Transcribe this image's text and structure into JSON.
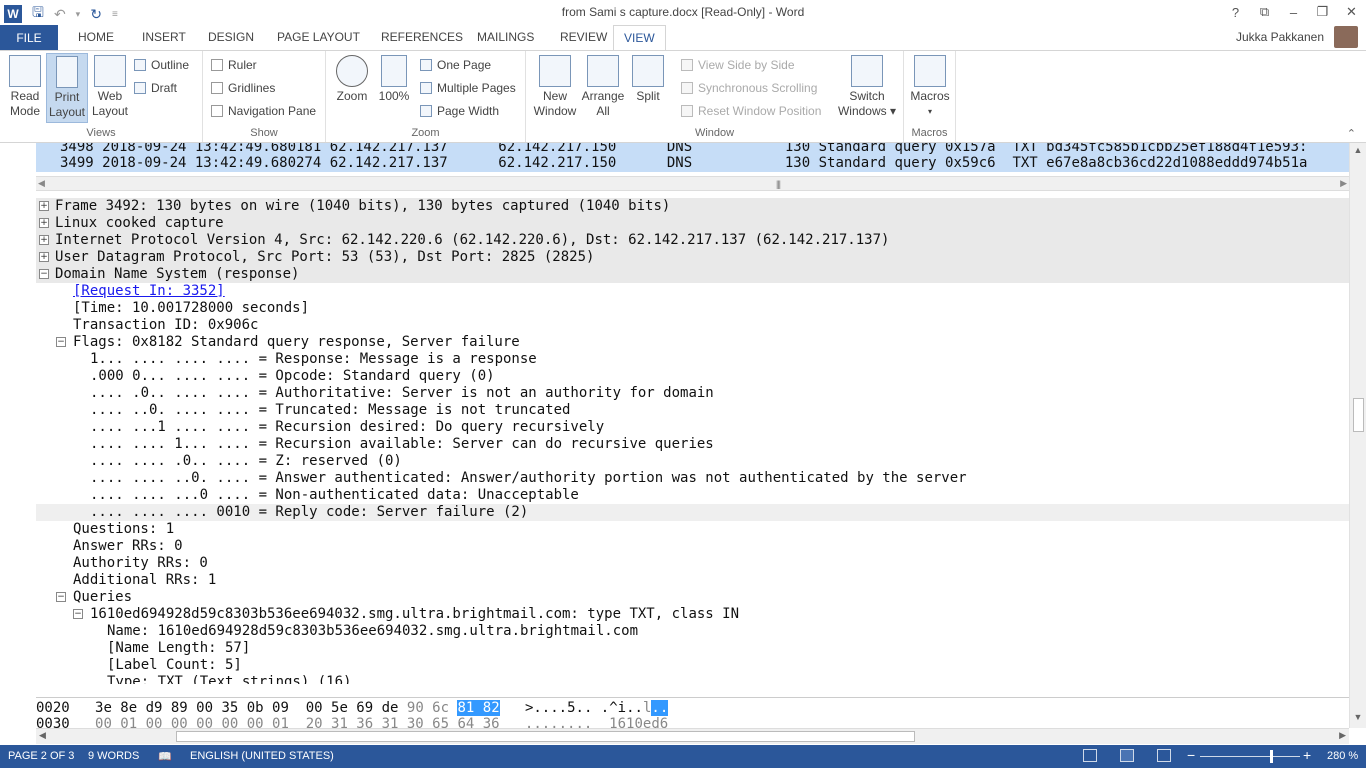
{
  "titlebar": {
    "title": "from Sami s capture.docx [Read-Only] - Word",
    "help": "?",
    "restore_ribbon": "⧉",
    "minimize": "–",
    "restore": "❐",
    "close": "✕"
  },
  "tabs": {
    "file": "FILE",
    "items": [
      "HOME",
      "INSERT",
      "DESIGN",
      "PAGE LAYOUT",
      "REFERENCES",
      "MAILINGS",
      "REVIEW",
      "VIEW"
    ],
    "active": "VIEW",
    "user": "Jukka Pakkanen"
  },
  "ribbon": {
    "views": {
      "label": "Views",
      "read_mode": [
        "Read",
        "Mode"
      ],
      "print_layout": [
        "Print",
        "Layout"
      ],
      "web_layout": [
        "Web",
        "Layout"
      ],
      "outline": "Outline",
      "draft": "Draft"
    },
    "show": {
      "label": "Show",
      "ruler": "Ruler",
      "gridlines": "Gridlines",
      "navigation_pane": "Navigation Pane"
    },
    "zoom": {
      "label": "Zoom",
      "zoom": "Zoom",
      "hundred": "100%",
      "one_page": "One Page",
      "multiple_pages": "Multiple Pages",
      "page_width": "Page Width"
    },
    "window": {
      "label": "Window",
      "new_window": [
        "New",
        "Window"
      ],
      "arrange_all": [
        "Arrange",
        "All"
      ],
      "split": "Split",
      "view_side_by_side": "View Side by Side",
      "synchronous_scrolling": "Synchronous Scrolling",
      "reset_window_position": "Reset Window Position",
      "switch_windows": [
        "Switch",
        "Windows ▾"
      ]
    },
    "macros": {
      "label": "Macros",
      "macros": [
        "Macros",
        "▾"
      ]
    }
  },
  "packet_list": [
    "3498 2018-09-24 13:42:49.680181 62.142.217.137      62.142.217.150      DNS           130 Standard query 0x157a  TXT bd345fc585b1cbb25ef188d4f1e593:",
    "3499 2018-09-24 13:42:49.680274 62.142.217.137      62.142.217.150      DNS           130 Standard query 0x59c6  TXT e67e8a8cb36cd22d1088eddd974b51a"
  ],
  "tree": {
    "frame": "Frame 3492: 130 bytes on wire (1040 bits), 130 bytes captured (1040 bits)",
    "linux": "Linux cooked capture",
    "ip": "Internet Protocol Version 4, Src: 62.142.220.6 (62.142.220.6), Dst: 62.142.217.137 (62.142.217.137)",
    "udp": "User Datagram Protocol, Src Port: 53 (53), Dst Port: 2825 (2825)",
    "dns": "Domain Name System (response)",
    "request_in": "[Request In: 3352]",
    "time": "[Time: 10.001728000 seconds]",
    "transaction": "Transaction ID: 0x906c",
    "flags": "Flags: 0x8182 Standard query response, Server failure",
    "flag_lines": [
      "1... .... .... .... = Response: Message is a response",
      ".000 0... .... .... = Opcode: Standard query (0)",
      ".... .0.. .... .... = Authoritative: Server is not an authority for domain",
      ".... ..0. .... .... = Truncated: Message is not truncated",
      ".... ...1 .... .... = Recursion desired: Do query recursively",
      ".... .... 1... .... = Recursion available: Server can do recursive queries",
      ".... .... .0.. .... = Z: reserved (0)",
      ".... .... ..0. .... = Answer authenticated: Answer/authority portion was not authenticated by the server",
      ".... .... ...0 .... = Non-authenticated data: Unacceptable",
      ".... .... .... 0010 = Reply code: Server failure (2)"
    ],
    "questions": "Questions: 1",
    "answer_rrs": "Answer RRs: 0",
    "authority_rrs": "Authority RRs: 0",
    "additional_rrs": "Additional RRs: 1",
    "queries": "Queries",
    "query": "1610ed694928d59c8303b536ee694032.smg.ultra.brightmail.com: type TXT, class IN",
    "name": "Name: 1610ed694928d59c8303b536ee694032.smg.ultra.brightmail.com",
    "name_length": "[Name Length: 57]",
    "label_count": "[Label Count: 5]",
    "type_partial": "Type: TXT (Text strings) (16)"
  },
  "hex": {
    "row1_offset": "0020",
    "row1_bytes": "3e 8e d9 89 00 35 0b 09  00 5e 69 de",
    "row1_dim": "90 6c",
    "row1_sel": "81 82",
    "row1_ascii": ">....5.. .^i..",
    "row1_ascii_dim": "l",
    "row1_ascii_sel": "..",
    "row2_offset": "0030",
    "row2_bytes": "00 01 00 00 00 00 00 01  20 31 36 31 30 65 64 36",
    "row2_ascii": "........  1610ed6"
  },
  "statusbar": {
    "page": "PAGE 2 OF 3",
    "words": "9 WORDS",
    "language": "ENGLISH (UNITED STATES)",
    "zoom": "280 %",
    "zoom_minus": "−",
    "zoom_plus": "+"
  },
  "colors": {
    "accent": "#2b579a",
    "packet_highlight": "#c6ddf7",
    "selection": "#3399ff"
  }
}
